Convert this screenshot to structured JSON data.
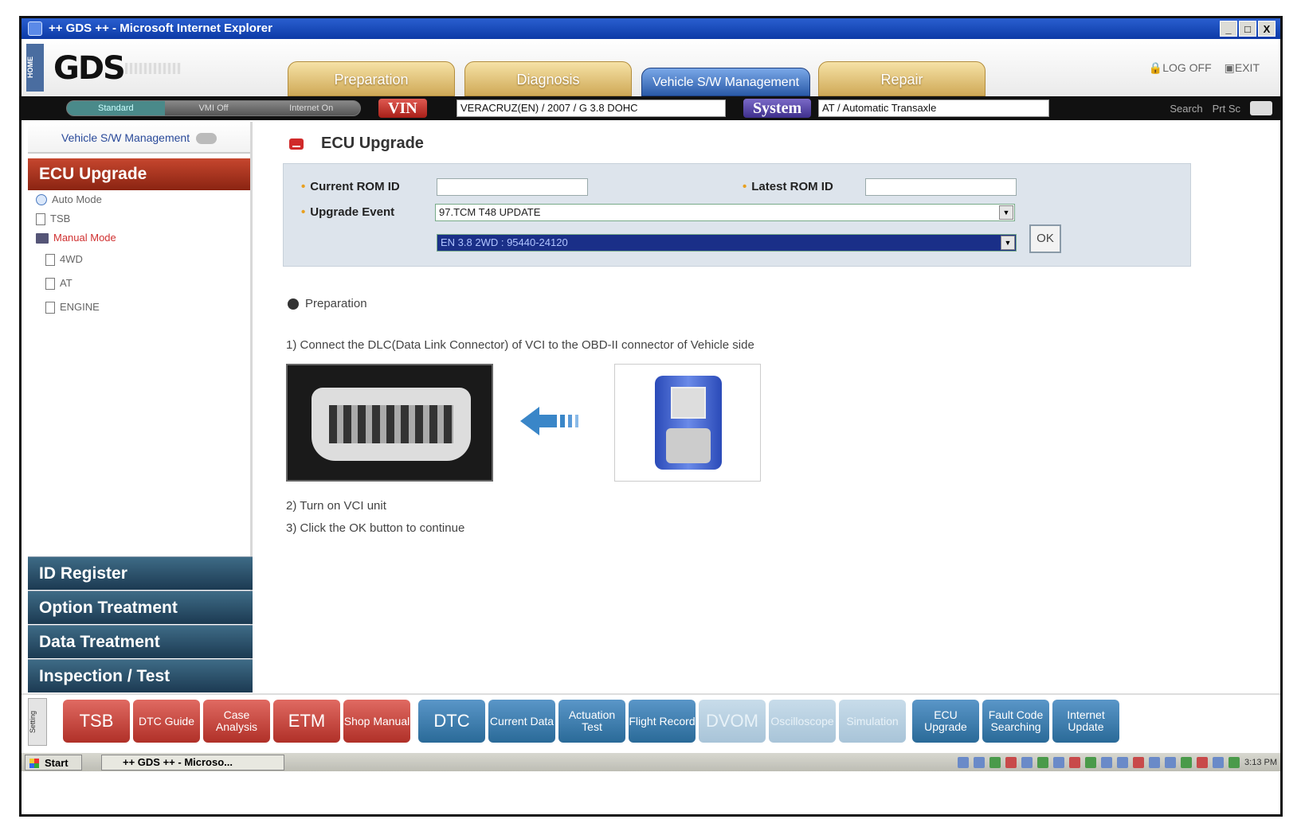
{
  "window": {
    "title": "++ GDS ++ - Microsoft Internet Explorer",
    "controls": [
      "_",
      "□",
      "X"
    ]
  },
  "header": {
    "home_label": "HOME",
    "logo": "GDS",
    "tabs": [
      {
        "label": "Preparation"
      },
      {
        "label": "Diagnosis"
      },
      {
        "label": "Vehicle S/W Management"
      },
      {
        "label": "Repair"
      }
    ],
    "log_off": "LOG OFF",
    "exit": "EXIT"
  },
  "toolbar": {
    "modes": [
      "Standard",
      "VMI Off",
      "Internet On"
    ],
    "vin_label": "VIN",
    "vin_value": "VERACRUZ(EN) / 2007 / G 3.8 DOHC",
    "system_label": "System",
    "system_value": "AT / Automatic Transaxle",
    "search": "Search",
    "prt_sc": "Prt Sc"
  },
  "sidebar": {
    "header": "Vehicle S/W Management",
    "active_section": "ECU Upgrade",
    "tree": [
      {
        "label": "Auto Mode"
      },
      {
        "label": "TSB"
      },
      {
        "label": "Manual Mode"
      },
      {
        "label": "4WD"
      },
      {
        "label": "AT"
      },
      {
        "label": "ENGINE"
      }
    ],
    "sections": [
      "ID Register",
      "Option Treatment",
      "Data Treatment",
      "Inspection / Test"
    ]
  },
  "main": {
    "title": "ECU Upgrade",
    "form": {
      "current_rom_label": "Current ROM ID",
      "current_rom_value": "",
      "latest_rom_label": "Latest ROM ID",
      "latest_rom_value": "",
      "upgrade_event_label": "Upgrade Event",
      "upgrade_event_value": "97.TCM T48 UPDATE",
      "second_select_value": "EN 3.8 2WD : 95440-24120",
      "ok_label": "OK"
    },
    "preparation_label": "Preparation",
    "steps": [
      "1) Connect the DLC(Data Link Connector) of VCI to the OBD-II connector of Vehicle side",
      "2) Turn on VCI unit",
      "3) Click the OK button to continue"
    ]
  },
  "bottombar": {
    "setting_label": "Setting",
    "buttons": [
      {
        "label": "TSB"
      },
      {
        "label": "DTC Guide"
      },
      {
        "label": "Case Analysis"
      },
      {
        "label": "ETM"
      },
      {
        "label": "Shop Manual"
      },
      {
        "label": "DTC"
      },
      {
        "label": "Current Data"
      },
      {
        "label": "Actuation Test"
      },
      {
        "label": "Flight Record"
      },
      {
        "label": "DVOM"
      },
      {
        "label": "Oscilloscope"
      },
      {
        "label": "Simulation"
      },
      {
        "label": "ECU Upgrade"
      },
      {
        "label": "Fault Code Searching"
      },
      {
        "label": "Internet Update"
      }
    ]
  },
  "taskbar": {
    "start": "Start",
    "task": "++ GDS ++ - Microso...",
    "clock": "3:13 PM"
  },
  "colors": {
    "accent_red": "#b83a22",
    "sidebar_dark": "#2a4a62",
    "active_tab": "#2a5aa8"
  }
}
